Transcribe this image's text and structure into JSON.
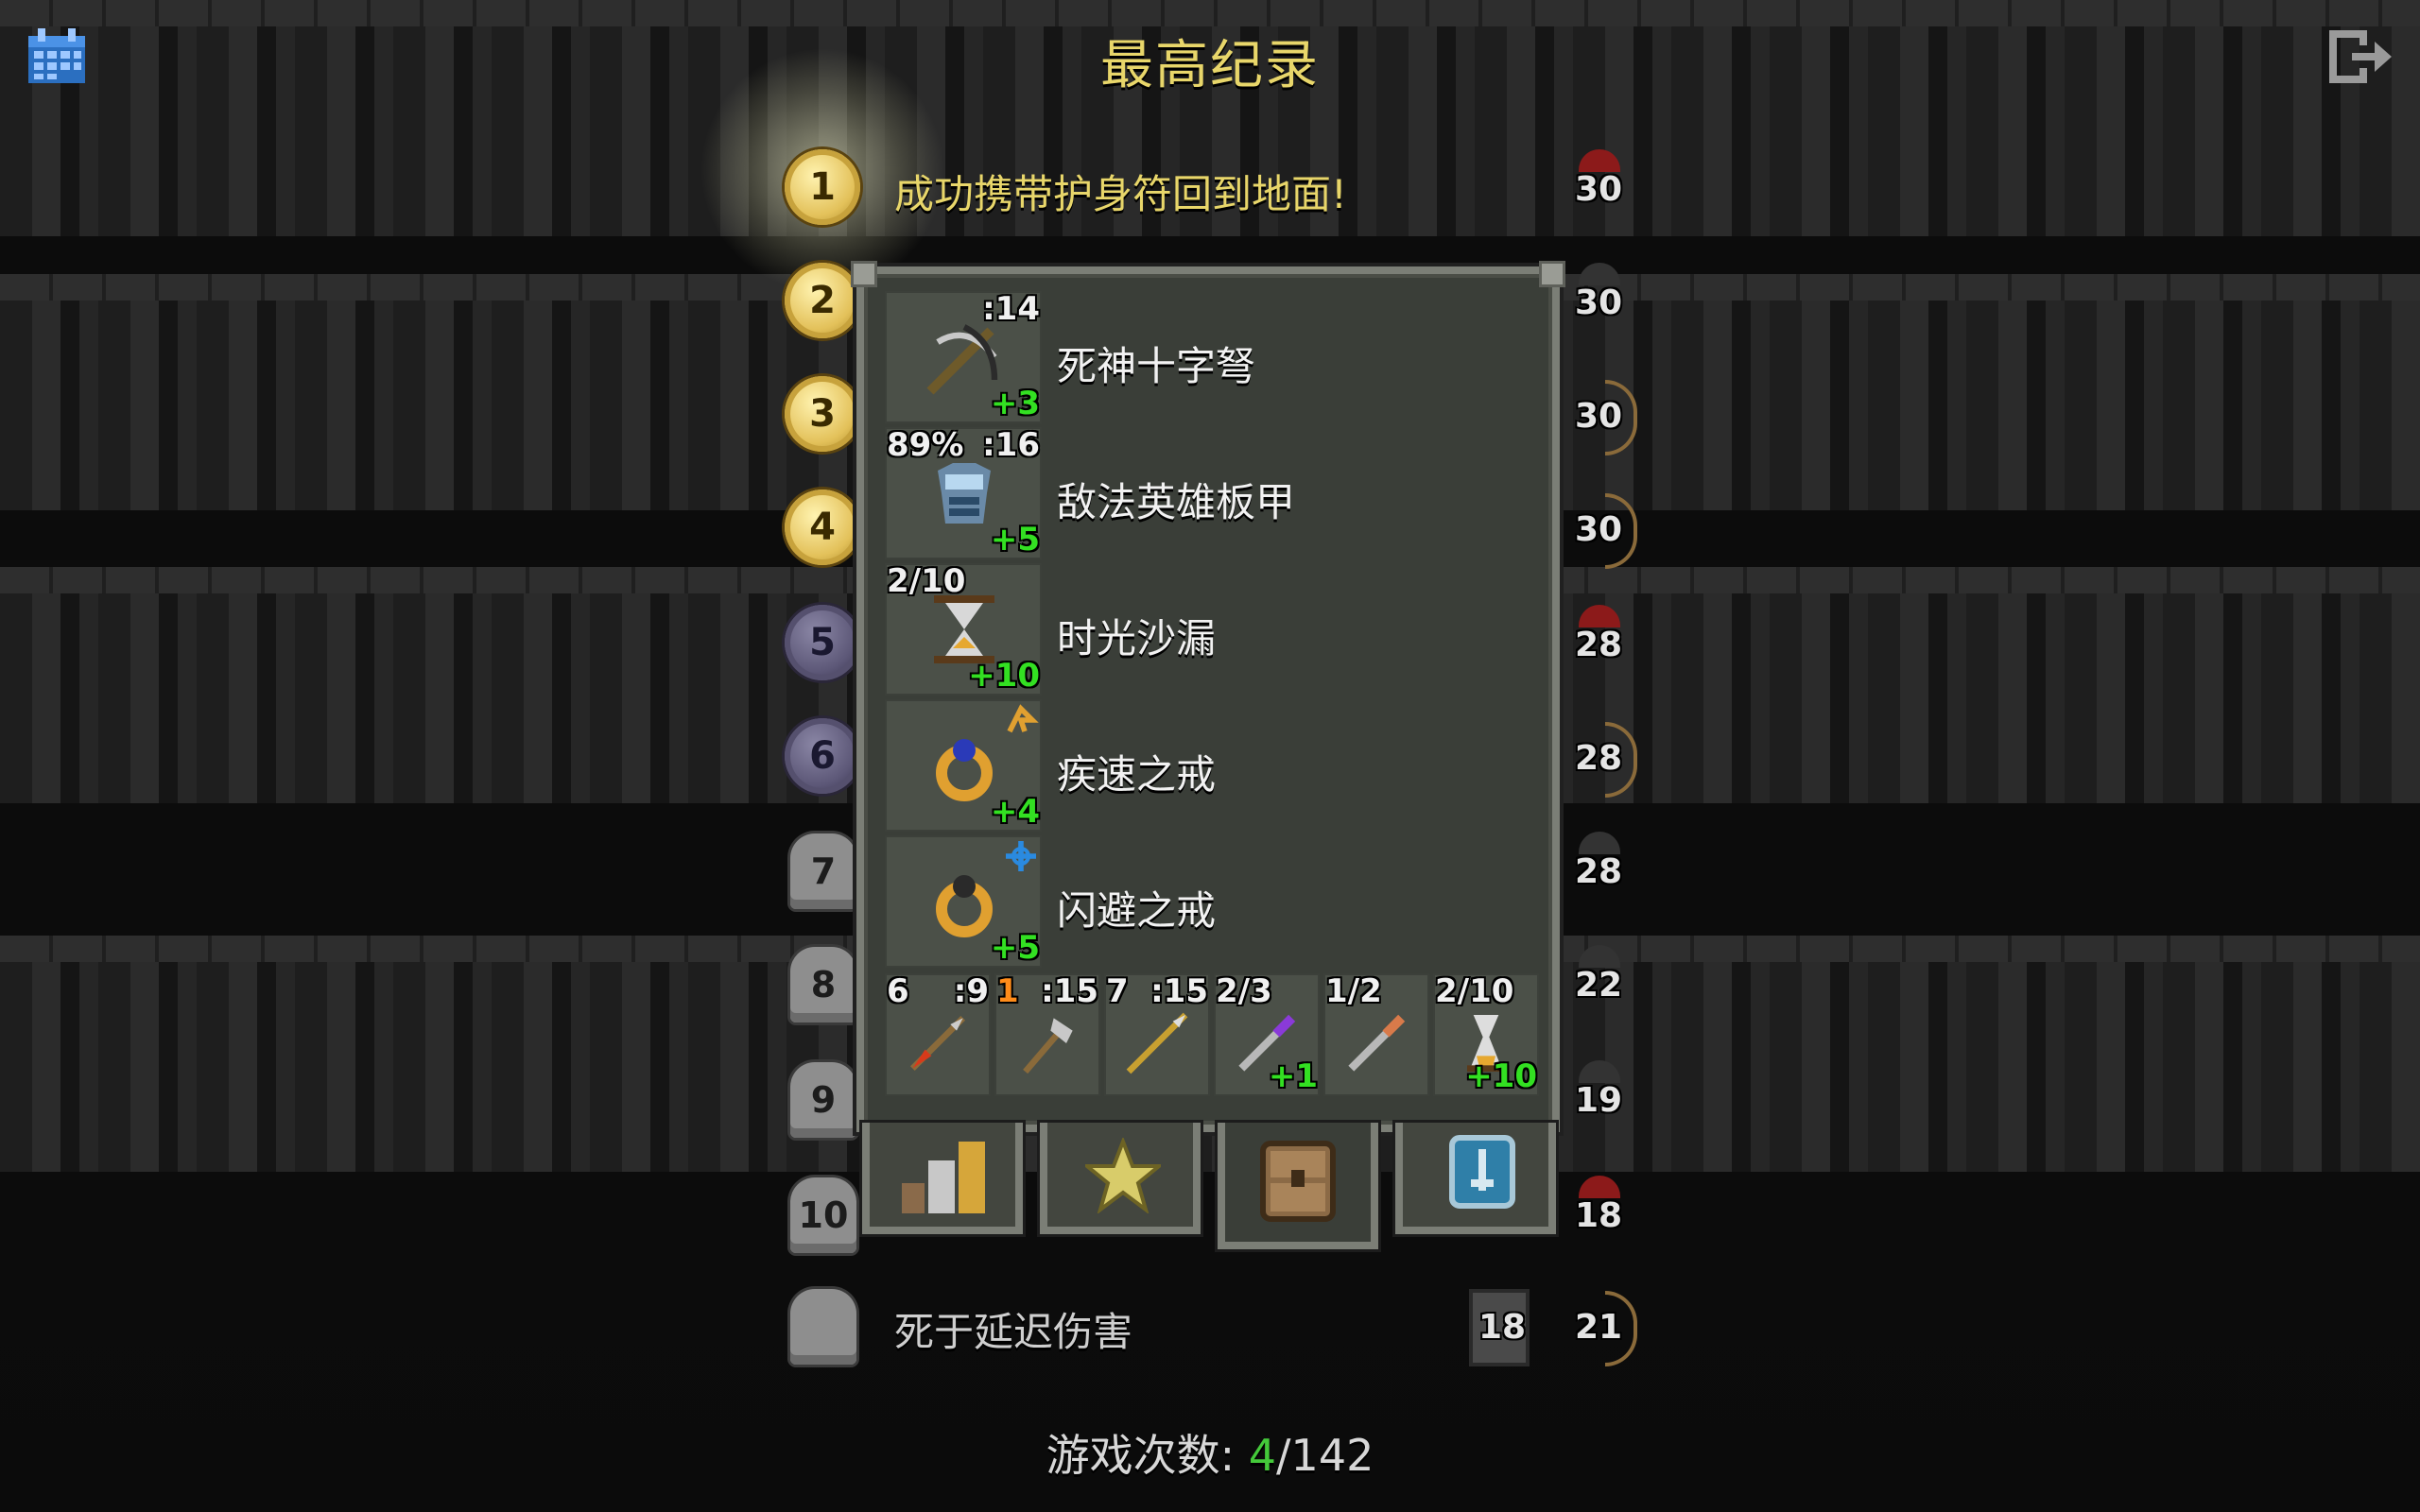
{
  "title": "最高纪录",
  "icons": {
    "calendar": "calendar-icon",
    "exit": "exit-icon"
  },
  "rankings": [
    {
      "rank": "1",
      "text": "成功携带护身符回到地面!",
      "level": "30",
      "hero": "warrior",
      "medal": "gold"
    },
    {
      "rank": "2",
      "text": "",
      "level": "30",
      "hero": "rogue",
      "medal": "gold"
    },
    {
      "rank": "3",
      "text": "",
      "level": "30",
      "hero": "huntress",
      "medal": "gold"
    },
    {
      "rank": "4",
      "text": "",
      "level": "30",
      "hero": "huntress",
      "medal": "gold"
    },
    {
      "rank": "5",
      "text": "",
      "level": "28",
      "hero": "warrior",
      "medal": "dark"
    },
    {
      "rank": "6",
      "text": "",
      "level": "28",
      "hero": "huntress",
      "medal": "dark"
    },
    {
      "rank": "7",
      "text": "",
      "level": "28",
      "hero": "mage",
      "medal": "tomb"
    },
    {
      "rank": "8",
      "text": "",
      "level": "22",
      "hero": "mage",
      "medal": "tomb"
    },
    {
      "rank": "9",
      "text": "",
      "level": "19",
      "hero": "rogue",
      "medal": "tomb"
    },
    {
      "rank": "10",
      "text": "",
      "level": "18",
      "hero": "warrior",
      "medal": "tomb"
    },
    {
      "rank": "",
      "text": "死于延迟伤害",
      "level": "21",
      "depth": "18",
      "hero": "huntress",
      "medal": "tomb-blank"
    }
  ],
  "inventory": {
    "items": [
      {
        "name": "死神十字弩",
        "top_left": "",
        "top_right": ":14",
        "bottom_right": "+3",
        "icon": "crossbow-icon"
      },
      {
        "name": "敌法英雄板甲",
        "top_left": "89%",
        "top_right": ":16",
        "bottom_right": "+5",
        "icon": "plate-armor-icon"
      },
      {
        "name": "时光沙漏",
        "top_left": "2/10",
        "top_right": "",
        "bottom_right": "+10",
        "icon": "hourglass-icon"
      },
      {
        "name": "疾速之戒",
        "top_left": "",
        "top_right": "haste-rune-icon",
        "bottom_right": "+4",
        "icon": "ring-of-haste-icon"
      },
      {
        "name": "闪避之戒",
        "top_left": "",
        "top_right": "evasion-rune-icon",
        "bottom_right": "+5",
        "icon": "ring-of-evasion-icon"
      }
    ],
    "bag": [
      {
        "top_left": "6",
        "top_right": ":9",
        "bottom_right": "",
        "icon": "fire-arrow-icon"
      },
      {
        "top_left": "1",
        "top_right": ":15",
        "bottom_right": "",
        "icon": "throwing-axe-icon"
      },
      {
        "top_left": "7",
        "top_right": ":15",
        "bottom_right": "",
        "icon": "javelin-icon"
      },
      {
        "top_left": "2/3",
        "top_right": "",
        "bottom_right": "+1",
        "icon": "wand-purple-icon"
      },
      {
        "top_left": "1/2",
        "top_right": "",
        "bottom_right": "",
        "icon": "wand-copper-icon"
      },
      {
        "top_left": "2/10",
        "top_right": "",
        "bottom_right": "+10",
        "icon": "artifact-flask-icon"
      }
    ],
    "tabs": [
      {
        "name": "stats-tab",
        "icon": "bar-chart-icon"
      },
      {
        "name": "badges-tab",
        "icon": "star-icon"
      },
      {
        "name": "items-tab",
        "icon": "backpack-icon",
        "active": true
      },
      {
        "name": "challenges-tab",
        "icon": "scroll-icon"
      }
    ]
  },
  "footer": {
    "label": "游戏次数:",
    "wins": "4",
    "separator": "/",
    "total": "142"
  },
  "colors": {
    "title": "#e8d66a",
    "positive": "#33e022",
    "accent_green": "#44c93a"
  }
}
